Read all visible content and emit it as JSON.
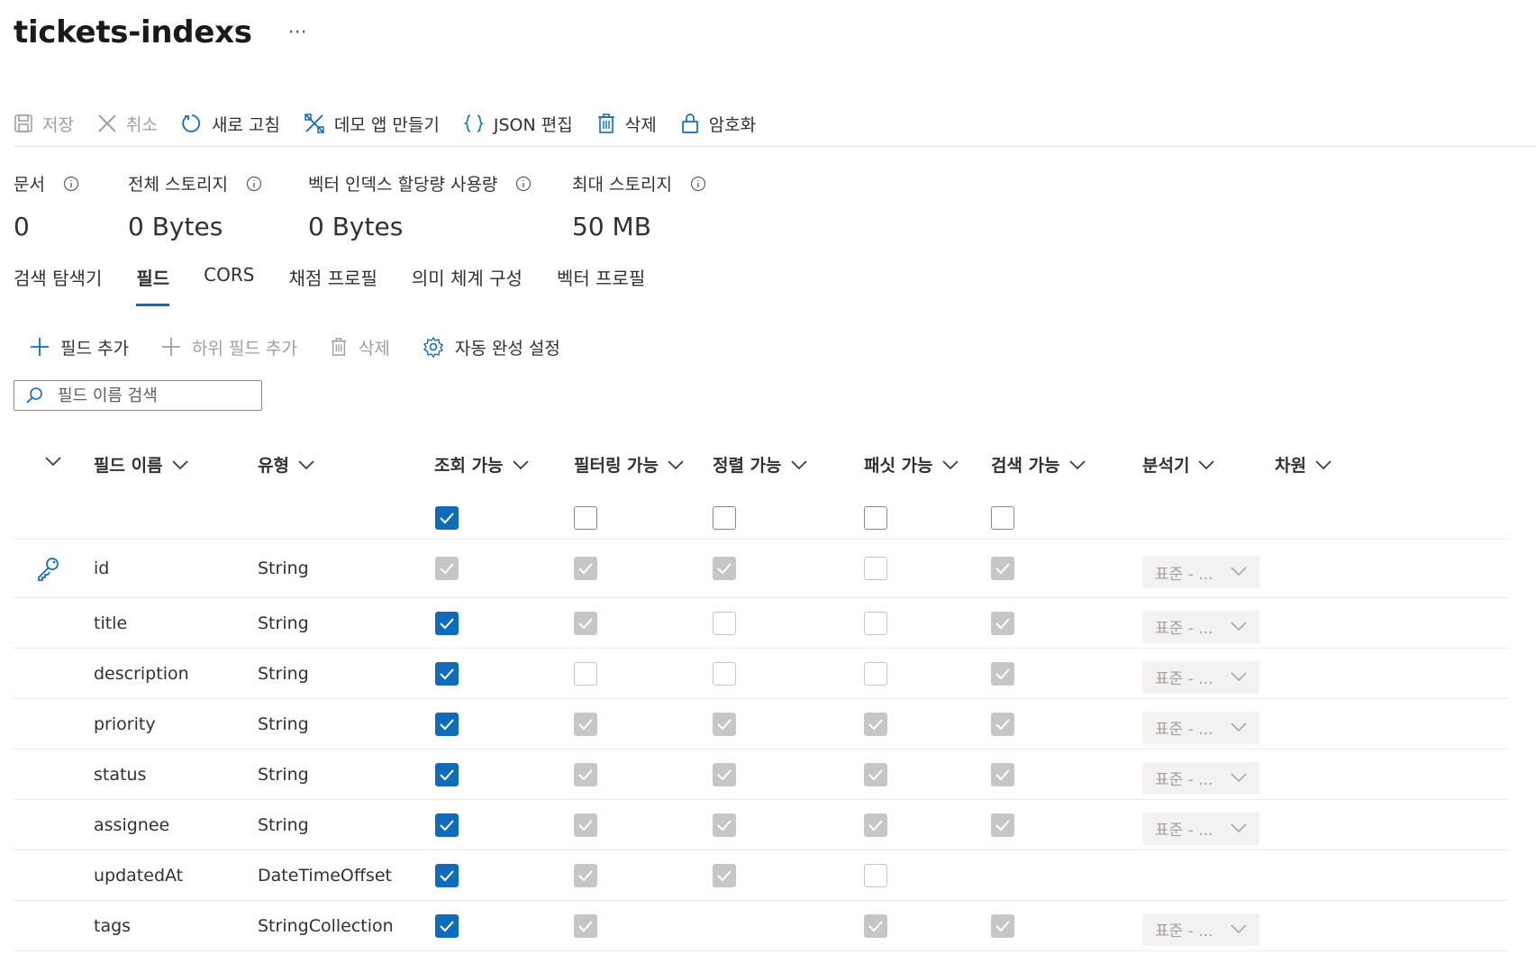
{
  "title": "tickets-indexs",
  "title_more": "···",
  "toolbar": {
    "save": "저장",
    "cancel": "취소",
    "refresh": "새로 고침",
    "demo": "데모 앱 만들기",
    "json": "JSON 편집",
    "delete": "삭제",
    "encrypt": "암호화"
  },
  "stats": [
    {
      "label": "문서",
      "value": "0"
    },
    {
      "label": "전체 스토리지",
      "value": "0 Bytes"
    },
    {
      "label": "벡터 인덱스 할당량 사용량",
      "value": "0 Bytes"
    },
    {
      "label": "최대 스토리지",
      "value": "50 MB"
    }
  ],
  "tabs": [
    "검색 탐색기",
    "필드",
    "CORS",
    "채점 프로필",
    "의미 체계 구성",
    "벡터 프로필"
  ],
  "active_tab": "필드",
  "commands": {
    "add_field": "필드 추가",
    "add_subfield": "하위 필드 추가",
    "delete": "삭제",
    "autocomplete": "자동 완성 설정"
  },
  "search": {
    "placeholder": "필드 이름 검색"
  },
  "columns": {
    "name": "필드 이름",
    "type": "유형",
    "retrievable": "조회 가능",
    "filterable": "필터링 가능",
    "sortable": "정렬 가능",
    "facetable": "패싯 가능",
    "searchable": "검색 가능",
    "analyzer": "분석기",
    "dimensions": "차원"
  },
  "select_row": {
    "retrievable": "on",
    "filterable": "off",
    "sortable": "off",
    "facetable": "off",
    "searchable": "off"
  },
  "rows": [
    {
      "key": true,
      "name": "id",
      "type": "String",
      "retrievable": "dis",
      "filterable": "dis",
      "sortable": "dis",
      "facetable": "disoff",
      "searchable": "dis",
      "analyzer": "표준 - ..."
    },
    {
      "key": false,
      "name": "title",
      "type": "String",
      "retrievable": "on",
      "filterable": "dis",
      "sortable": "disoff",
      "facetable": "disoff",
      "searchable": "dis",
      "analyzer": "표준 - ..."
    },
    {
      "key": false,
      "name": "description",
      "type": "String",
      "retrievable": "on",
      "filterable": "disoff",
      "sortable": "disoff",
      "facetable": "disoff",
      "searchable": "dis",
      "analyzer": "표준 - ..."
    },
    {
      "key": false,
      "name": "priority",
      "type": "String",
      "retrievable": "on",
      "filterable": "dis",
      "sortable": "dis",
      "facetable": "dis",
      "searchable": "dis",
      "analyzer": "표준 - ..."
    },
    {
      "key": false,
      "name": "status",
      "type": "String",
      "retrievable": "on",
      "filterable": "dis",
      "sortable": "dis",
      "facetable": "dis",
      "searchable": "dis",
      "analyzer": "표준 - ..."
    },
    {
      "key": false,
      "name": "assignee",
      "type": "String",
      "retrievable": "on",
      "filterable": "dis",
      "sortable": "dis",
      "facetable": "dis",
      "searchable": "dis",
      "analyzer": "표준 - ..."
    },
    {
      "key": false,
      "name": "updatedAt",
      "type": "DateTimeOffset",
      "retrievable": "on",
      "filterable": "dis",
      "sortable": "dis",
      "facetable": "disoff",
      "searchable": null,
      "analyzer": null
    },
    {
      "key": false,
      "name": "tags",
      "type": "StringCollection",
      "retrievable": "on",
      "filterable": "dis",
      "sortable": null,
      "facetable": "dis",
      "searchable": "dis",
      "analyzer": "표준 - ..."
    }
  ],
  "colors": {
    "accent": "#0f6cbd",
    "disabled_fill": "#c8c6c4",
    "text": "#323130"
  },
  "icons": [
    "save-icon",
    "cancel-icon",
    "refresh-icon",
    "demo-app-icon",
    "json-braces-icon",
    "trash-icon",
    "lock-icon",
    "info-icon",
    "plus-icon",
    "gear-icon",
    "search-icon",
    "key-icon",
    "chevron-down-icon",
    "checkmark-icon"
  ]
}
